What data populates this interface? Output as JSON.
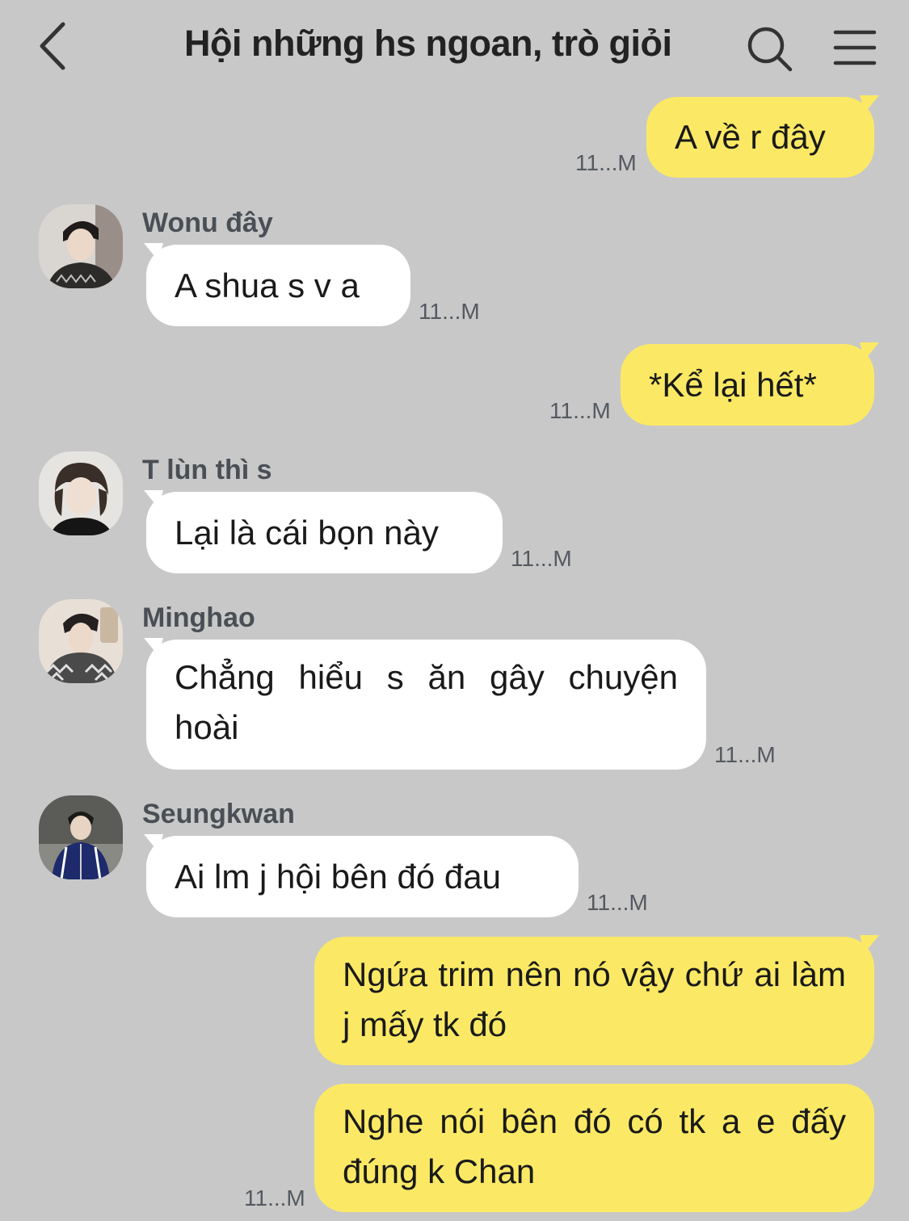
{
  "header": {
    "title": "Hội những hs ngoan, trò giỏi"
  },
  "messages": [
    {
      "direction": "out",
      "text": "A về r đây",
      "time": "11...M"
    },
    {
      "direction": "in",
      "sender": "Wonu đây",
      "text": "A shua s v a",
      "time": "11...M"
    },
    {
      "direction": "out",
      "text": "*Kể lại hết*",
      "time": "11...M"
    },
    {
      "direction": "in",
      "sender": "T lùn thì s",
      "text": "Lại là cái bọn này",
      "time": "11...M"
    },
    {
      "direction": "in",
      "sender": "Minghao",
      "text": "Chẳng hiểu s ăn gây chuyện hoài",
      "time": "11...M"
    },
    {
      "direction": "in",
      "sender": "Seungkwan",
      "text": "Ai lm j hội bên đó đau",
      "time": "11...M"
    },
    {
      "direction": "out",
      "text": "Ngứa trim nên nó vậy chứ ai làm j mấy tk đó"
    },
    {
      "direction": "out",
      "text": "Nghe nói bên đó có tk a e đấy đúng k Chan",
      "time": "11...M"
    }
  ],
  "colors": {
    "background": "#c8c8c8",
    "outgoing_bubble": "#fbe965",
    "incoming_bubble": "#ffffff"
  }
}
